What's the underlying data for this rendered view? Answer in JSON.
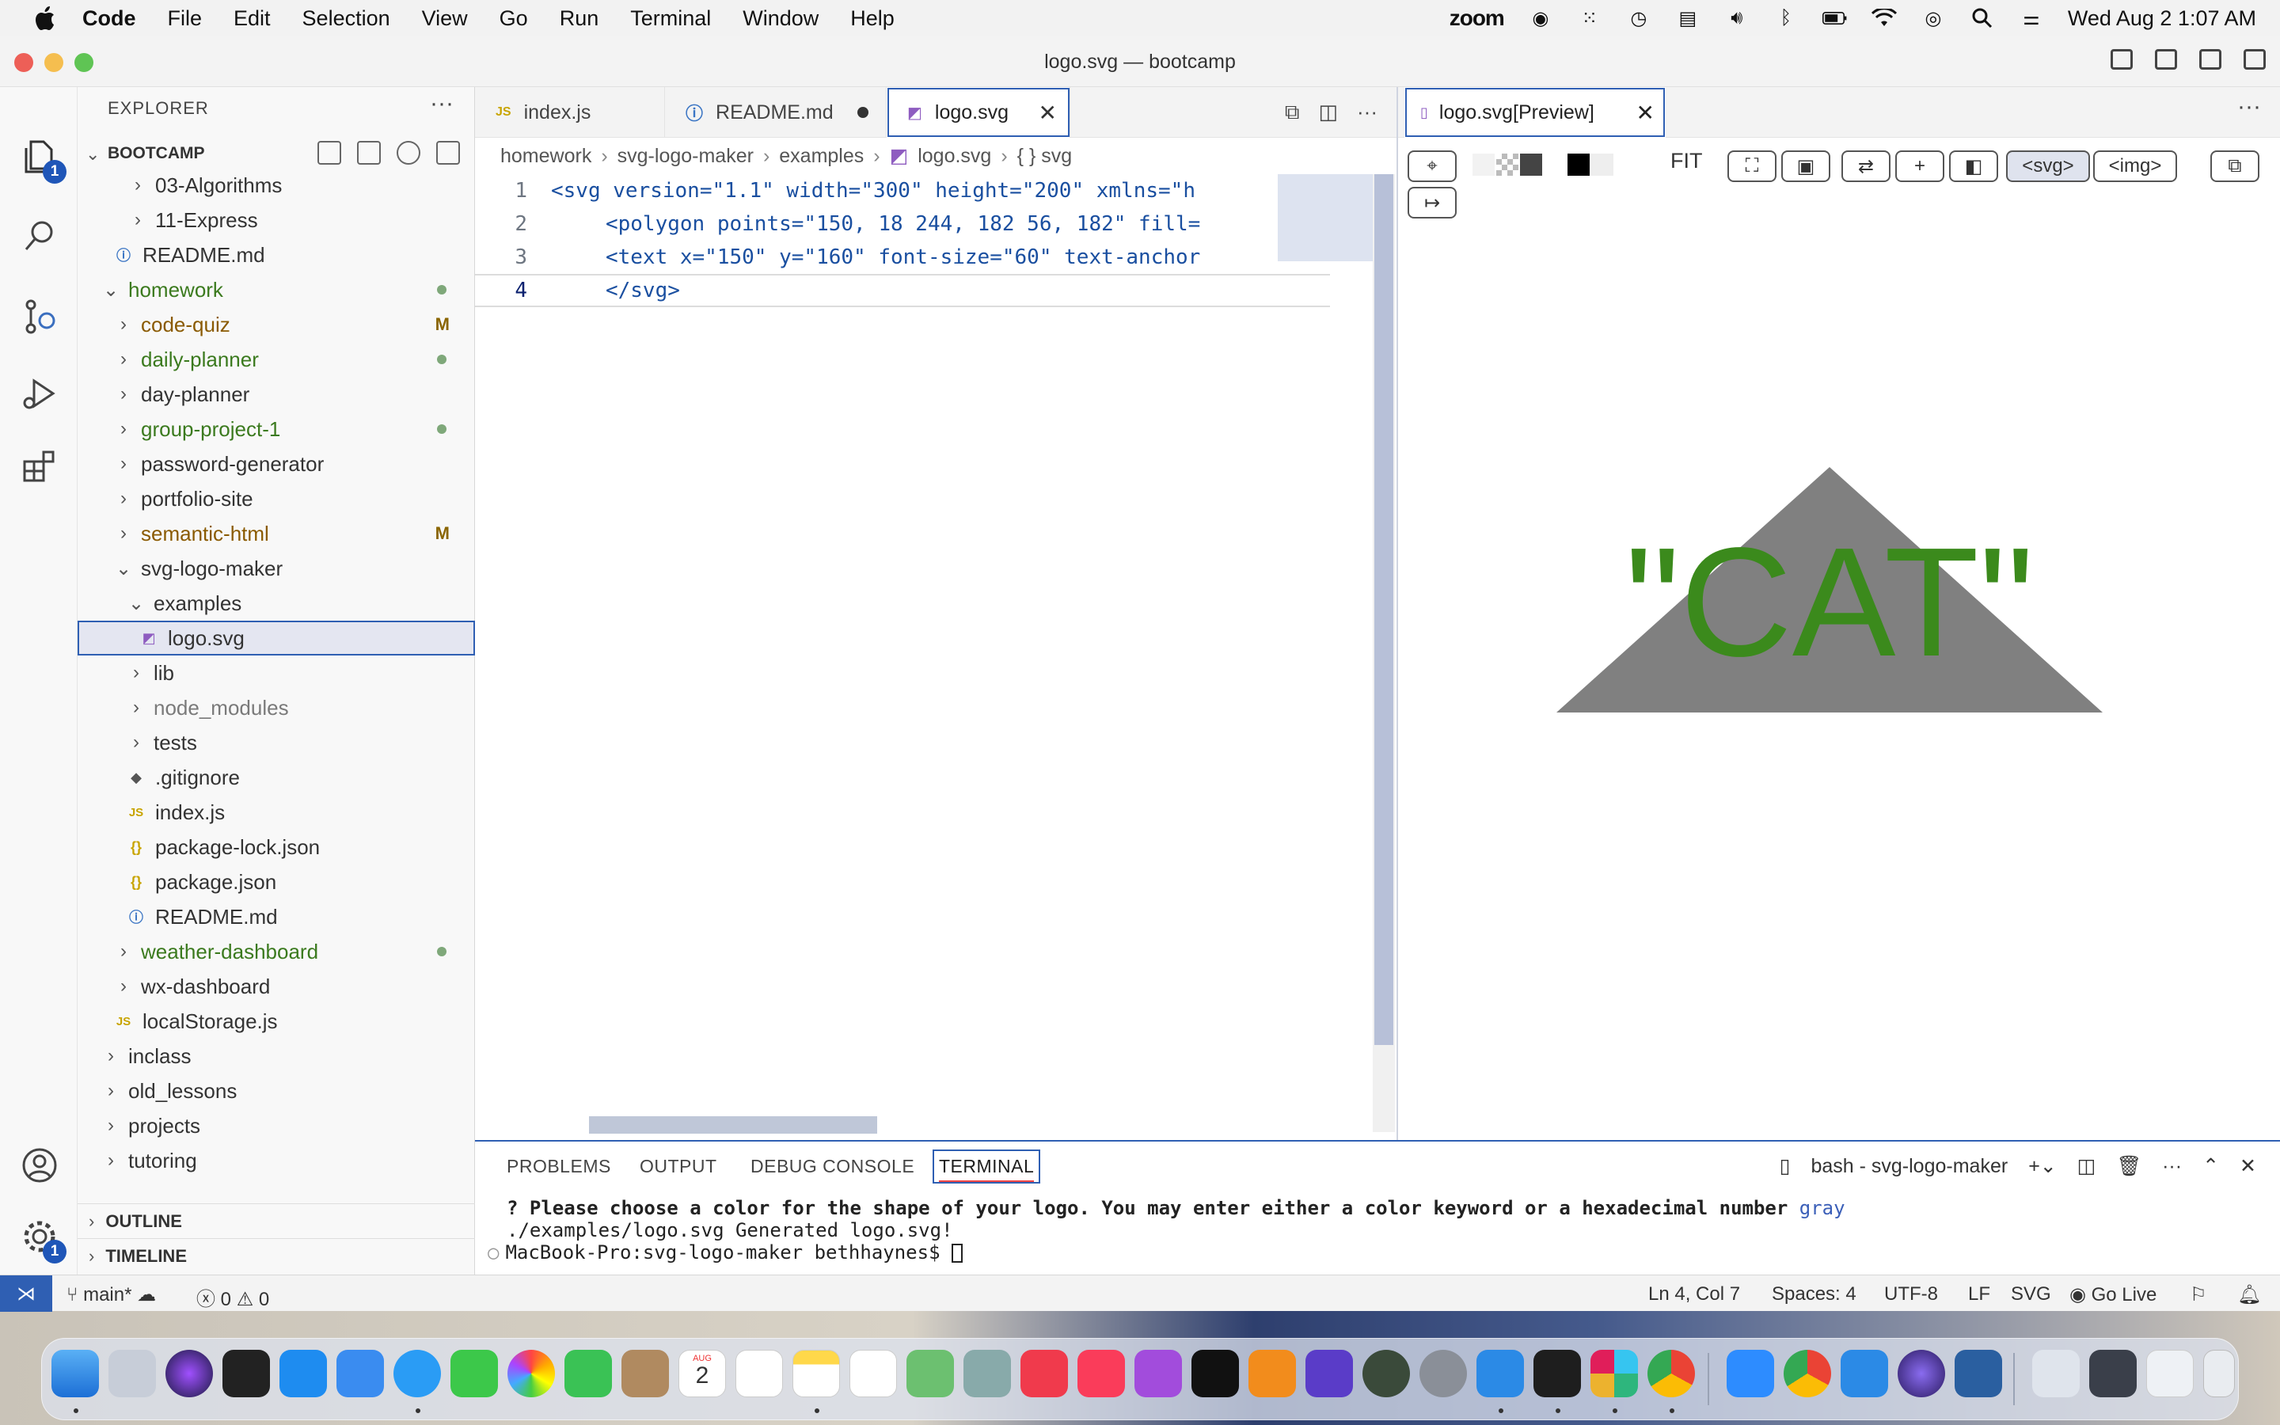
{
  "menubar": {
    "app": "Code",
    "items": [
      "File",
      "Edit",
      "Selection",
      "View",
      "Go",
      "Run",
      "Terminal",
      "Window",
      "Help"
    ],
    "zoom": "zoom",
    "clock": "Wed Aug 2  1:07 AM"
  },
  "window": {
    "title": "logo.svg — bootcamp"
  },
  "activity": {
    "explorer_badge": "1",
    "settings_badge": "1"
  },
  "explorer": {
    "header": "EXPLORER",
    "more": "···",
    "section": "BOOTCAMP",
    "rows": [
      {
        "label": "03-Algorithms",
        "kind": "folder",
        "state": "closed"
      },
      {
        "label": "11-Express",
        "kind": "folder",
        "state": "closed"
      },
      {
        "label": "README.md",
        "kind": "info"
      },
      {
        "label": "homework",
        "kind": "folder",
        "state": "open"
      },
      {
        "label": "code-quiz",
        "kind": "folder",
        "state": "closed",
        "deco": "M"
      },
      {
        "label": "daily-planner",
        "kind": "folder",
        "state": "closed"
      },
      {
        "label": "day-planner",
        "kind": "folder",
        "state": "closed"
      },
      {
        "label": "group-project-1",
        "kind": "folder",
        "state": "closed"
      },
      {
        "label": "password-generator",
        "kind": "folder",
        "state": "closed"
      },
      {
        "label": "portfolio-site",
        "kind": "folder",
        "state": "closed"
      },
      {
        "label": "semantic-html",
        "kind": "folder",
        "state": "closed",
        "deco": "M"
      },
      {
        "label": "svg-logo-maker",
        "kind": "folder",
        "state": "open"
      },
      {
        "label": "examples",
        "kind": "folder",
        "state": "open"
      },
      {
        "label": "logo.svg",
        "kind": "svg"
      },
      {
        "label": "lib",
        "kind": "folder",
        "state": "closed"
      },
      {
        "label": "node_modules",
        "kind": "folder",
        "state": "closed"
      },
      {
        "label": "tests",
        "kind": "folder",
        "state": "closed"
      },
      {
        "label": ".gitignore",
        "kind": "git"
      },
      {
        "label": "index.js",
        "kind": "js"
      },
      {
        "label": "package-lock.json",
        "kind": "json"
      },
      {
        "label": "package.json",
        "kind": "json"
      },
      {
        "label": "README.md",
        "kind": "info"
      },
      {
        "label": "weather-dashboard",
        "kind": "folder",
        "state": "closed"
      },
      {
        "label": "wx-dashboard",
        "kind": "folder",
        "state": "closed"
      },
      {
        "label": "localStorage.js",
        "kind": "js"
      },
      {
        "label": "inclass",
        "kind": "folder",
        "state": "closed"
      },
      {
        "label": "old_lessons",
        "kind": "folder",
        "state": "closed"
      },
      {
        "label": "projects",
        "kind": "folder",
        "state": "closed"
      },
      {
        "label": "tutoring",
        "kind": "folder",
        "state": "closed"
      }
    ],
    "outline": "OUTLINE",
    "timeline": "TIMELINE"
  },
  "editor": {
    "tabs": [
      {
        "label": "index.js",
        "icon": "JS"
      },
      {
        "label": "README.md",
        "icon": "ⓘ"
      },
      {
        "label": "logo.svg",
        "icon": "◩"
      }
    ],
    "breadcrumb": [
      "homework",
      "svg-logo-maker",
      "examples",
      "logo.svg",
      "{ } svg"
    ],
    "lines": [
      {
        "n": "1",
        "text": "<svg version=\"1.1\" width=\"300\" height=\"200\" xmlns=\"h"
      },
      {
        "n": "2",
        "text": "   <polygon points=\"150, 18 244, 182 56, 182\" fill="
      },
      {
        "n": "3",
        "text": "   <text x=\"150\" y=\"160\" font-size=\"60\" text-anchor"
      },
      {
        "n": "4",
        "text": "   </svg>"
      }
    ]
  },
  "preview": {
    "tab": "logo.svg[Preview]",
    "more": "···",
    "fit": "FIT",
    "svg_btn": "<svg>",
    "img_btn": "<img>",
    "logo_text": "\"CAT\"",
    "shape_color": "#808080",
    "text_color": "#3b8a1c"
  },
  "panel": {
    "tabs": [
      "PROBLEMS",
      "OUTPUT",
      "DEBUG CONSOLE",
      "TERMINAL"
    ],
    "terminal_name": "bash - svg-logo-maker",
    "line1_prompt": "? Please choose a color for the shape of your logo. You may enter either a color keyword or a hexadecimal number",
    "line1_answer": "gray",
    "line2": "./examples/logo.svg Generated logo.svg!",
    "line3": "MacBook-Pro:svg-logo-maker bethhaynes$ "
  },
  "status": {
    "branch": "main*",
    "errors": "0",
    "warnings": "0",
    "position": "Ln 4, Col 7",
    "spaces": "Spaces: 4",
    "encoding": "UTF-8",
    "eol": "LF",
    "language": "SVG",
    "golive": "Go Live"
  },
  "dock": {
    "calendar_day": "2",
    "calendar_month": "AUG"
  }
}
